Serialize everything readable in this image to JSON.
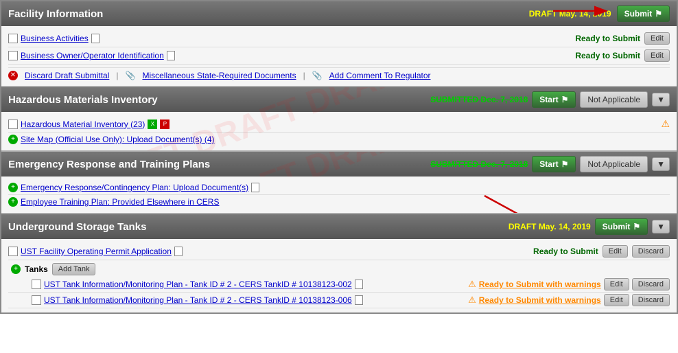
{
  "facility": {
    "section_title": "Facility Information",
    "draft_label": "DRAFT May. 14, 2019",
    "submit_btn": "Submit",
    "rows": [
      {
        "label": "Business Activities",
        "status": "Ready to Submit",
        "has_edit": true,
        "icon": "list"
      },
      {
        "label": "Business Owner/Operator Identification",
        "status": "Ready to Submit",
        "has_edit": true,
        "icon": "list"
      }
    ],
    "actions": [
      {
        "label": "Discard Draft Submittal",
        "icon": "circle-red"
      },
      {
        "label": "Miscellaneous State-Required Documents",
        "icon": "clip"
      },
      {
        "label": "Add Comment To Regulator",
        "icon": "clip"
      }
    ]
  },
  "hazardous": {
    "section_title": "Hazardous Materials Inventory",
    "submitted_label": "SUBMITTED Dec. 7, 2018",
    "start_btn": "Start",
    "not_applicable_btn": "Not Applicable",
    "rows": [
      {
        "label": "Hazardous Material Inventory (23)",
        "icon": "list",
        "has_extras": true
      },
      {
        "label": "Site Map (Official Use Only): Upload Document(s) (4)",
        "icon": "circle-green"
      }
    ]
  },
  "emergency": {
    "section_title": "Emergency Response and Training Plans",
    "submitted_label": "SUBMITTED Dec. 7, 2018",
    "start_btn": "Start",
    "not_applicable_btn": "Not Applicable",
    "rows": [
      {
        "label": "Emergency Response/Contingency Plan: Upload Document(s)",
        "icon": "circle-green"
      },
      {
        "label": "Employee Training Plan: Provided Elsewhere in CERS",
        "icon": "circle-green"
      }
    ]
  },
  "ust": {
    "section_title": "Underground Storage Tanks",
    "draft_label": "DRAFT May. 14, 2019",
    "submit_btn": "Submit",
    "ust_row": {
      "label": "UST Facility Operating Permit Application",
      "status": "Ready to Submit",
      "has_edit": true,
      "has_discard": true
    },
    "tanks_label": "Tanks",
    "add_tank_btn": "Add Tank",
    "tank_rows": [
      {
        "label": "UST Tank Information/Monitoring Plan - Tank ID # 2 - CERS TankID # 10138123-002",
        "status": "Ready to Submit with warnings",
        "has_edit": true,
        "has_discard": true
      },
      {
        "label": "UST Tank Information/Monitoring Plan - Tank ID # 2 - CERS TankID # 10138123-006",
        "status": "Ready to Submit with warnings",
        "has_edit": true,
        "has_discard": true
      }
    ]
  },
  "icons": {
    "submit_flag": "⚑",
    "start_flag": "⚑",
    "collapse": "▼",
    "warning": "⚠"
  }
}
